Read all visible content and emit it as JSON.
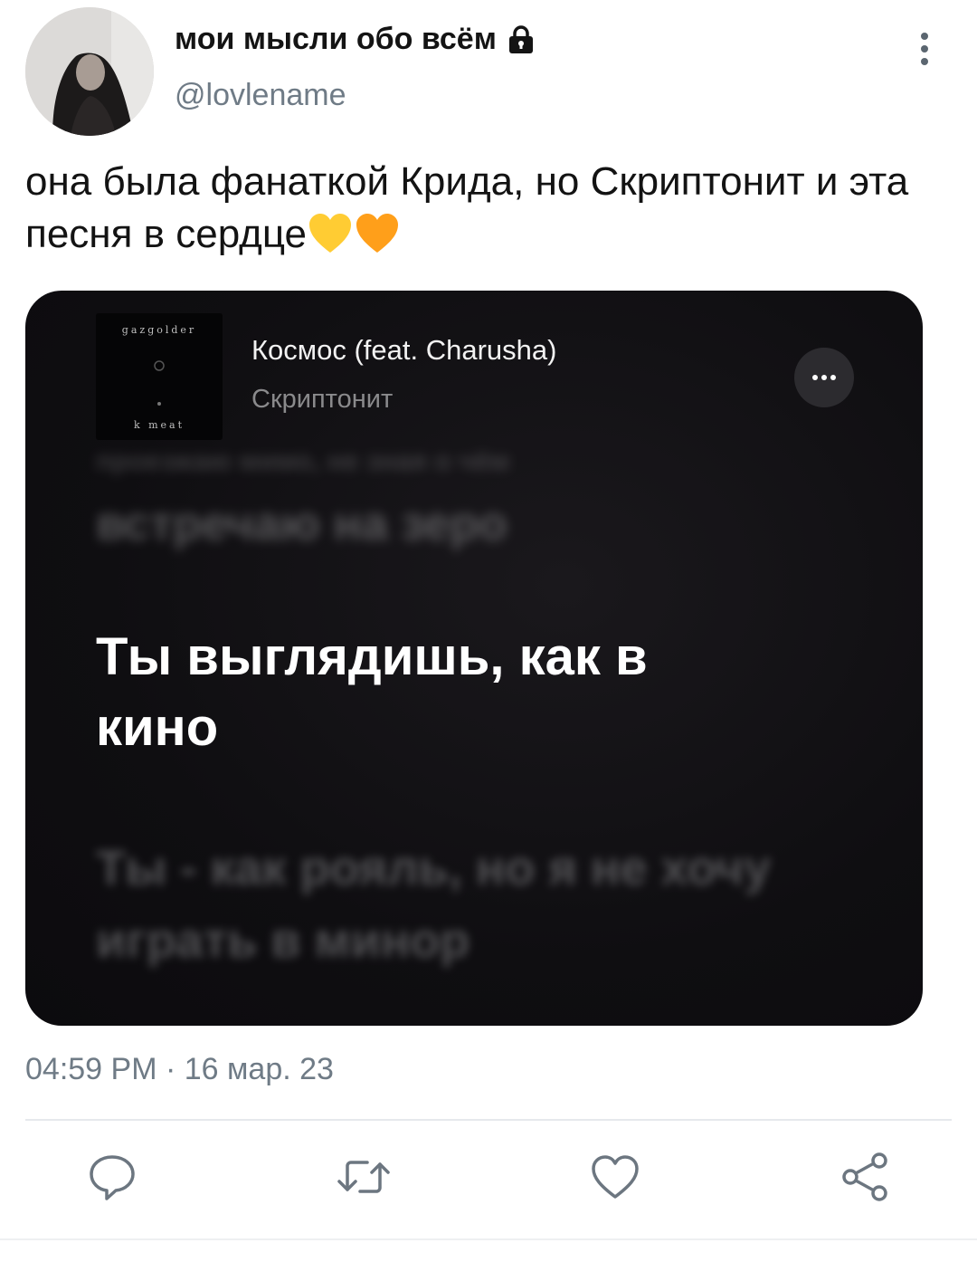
{
  "user": {
    "display_name": "мои мысли обо всём",
    "handle": "@lovlename",
    "verified_lock": "lock-icon"
  },
  "tweet": {
    "text": "она была фанаткой Крида, но Скриптонит и эта песня в сердце",
    "emojis": [
      "yellow-heart",
      "orange-heart"
    ]
  },
  "media": {
    "album_top_text": "gazgolder",
    "album_bottom_text": "k meat",
    "song_title": "Космос (feat. Charusha)",
    "artist": "Скриптонит",
    "lyric_prev_1": "проезжаю мимо, не зная о чём",
    "lyric_prev_2": "встречаю на зеро",
    "lyric_current": "Ты выглядишь, как в кино",
    "lyric_next": "Ты - как рояль, но я не хочу играть в минор"
  },
  "meta": {
    "time": "04:59 PM",
    "separator": "·",
    "date": "16 мар. 23"
  },
  "actions": [
    "reply-icon",
    "retweet-icon",
    "like-icon",
    "share-icon"
  ],
  "colors": {
    "secondary_text": "#6f7b86",
    "media_bg": "#0f0e11",
    "yellow_heart": "#ffcc33",
    "orange_heart": "#ff9f1a"
  }
}
